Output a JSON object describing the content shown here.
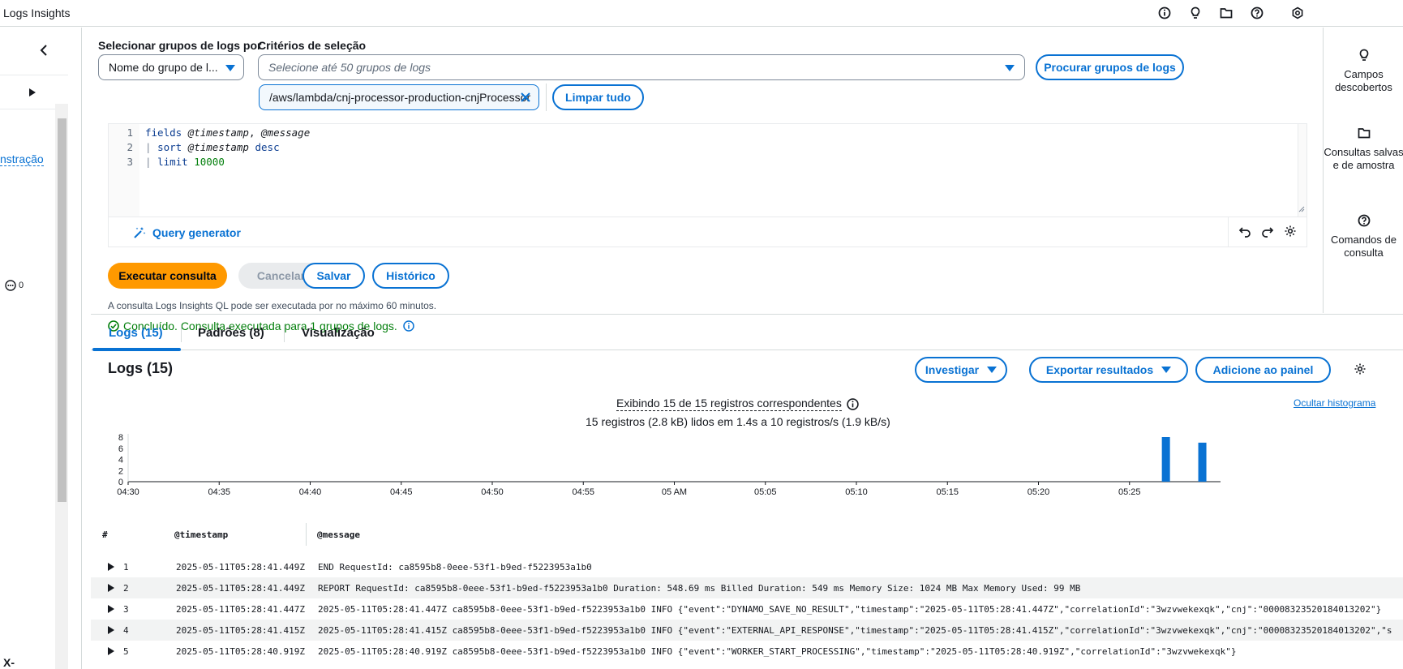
{
  "app": {
    "title": "Logs Insights"
  },
  "leftnav": {
    "link_text": "nstração",
    "count": "0",
    "bottom_text": "X-"
  },
  "query": {
    "select_groups_label": "Selecionar grupos de logs por",
    "select_groups_value": "Nome do grupo de l...",
    "criteria_label": "Critérios de seleção",
    "criteria_placeholder": "Selecione até 50 grupos de logs",
    "browse_button": "Procurar grupos de logs",
    "selected_token": "/aws/lambda/cnj-processor-production-cnjProcessor",
    "clear_all_button": "Limpar tudo",
    "editor_lines": [
      {
        "n": "1",
        "parts": [
          [
            "kw",
            "fields"
          ],
          [
            "",
            "",
            " "
          ],
          [
            "at",
            "@timestamp"
          ],
          [
            "",
            ", "
          ],
          [
            "at",
            "@message"
          ]
        ]
      },
      {
        "n": "2",
        "parts": [
          [
            "pipe",
            "| "
          ],
          [
            "kw",
            "sort"
          ],
          [
            "",
            " "
          ],
          [
            "at",
            "@timestamp"
          ],
          [
            "",
            " "
          ],
          [
            "kw",
            "desc"
          ]
        ]
      },
      {
        "n": "3",
        "parts": [
          [
            "pipe",
            "| "
          ],
          [
            "kw",
            "limit"
          ],
          [
            "",
            " "
          ],
          [
            "num",
            "10000"
          ]
        ]
      }
    ],
    "query_generator": "Query generator",
    "run_button": "Executar consulta",
    "cancel_button": "Cancelar",
    "save_button": "Salvar",
    "history_button": "Histórico",
    "hint": "A consulta Logs Insights QL pode ser executada por no máximo 60 minutos.",
    "status": "Concluído. Consulta executada para 1 grupos de logs."
  },
  "rightpanel": {
    "items": [
      {
        "label": "Campos descobertos",
        "icon": "lightbulb-icon"
      },
      {
        "label": "Consultas salvas e de amostra",
        "icon": "folder-icon"
      },
      {
        "label": "Comandos de consulta",
        "icon": "help-icon"
      }
    ]
  },
  "tabs": [
    {
      "label": "Logs (15)",
      "active": true
    },
    {
      "label": "Padrões (8)",
      "active": false
    },
    {
      "label": "Visualização",
      "active": false
    }
  ],
  "logs": {
    "title": "Logs (15)",
    "investigate_button": "Investigar",
    "export_button": "Exportar resultados",
    "add_dashboard_button": "Adicione ao painel",
    "hist_info1": "Exibindo 15 de 15 registros correspondentes",
    "hist_info2": "15 registros (2.8 kB) lidos em 1.4s a 10 registros/s (1.9 kB/s)",
    "hide_histogram": "Ocultar histograma",
    "columns": [
      "#",
      "@timestamp",
      "@message"
    ],
    "rows": [
      {
        "n": "1",
        "ts": "2025-05-11T05:28:41.449Z",
        "msg": "END RequestId: ca8595b8-0eee-53f1-b9ed-f5223953a1b0"
      },
      {
        "n": "2",
        "ts": "2025-05-11T05:28:41.449Z",
        "msg": "REPORT RequestId: ca8595b8-0eee-53f1-b9ed-f5223953a1b0 Duration: 548.69 ms Billed Duration: 549 ms Memory Size: 1024 MB Max Memory Used: 99 MB"
      },
      {
        "n": "3",
        "ts": "2025-05-11T05:28:41.447Z",
        "msg": "2025-05-11T05:28:41.447Z ca8595b8-0eee-53f1-b9ed-f5223953a1b0 INFO {\"event\":\"DYNAMO_SAVE_NO_RESULT\",\"timestamp\":\"2025-05-11T05:28:41.447Z\",\"correlationId\":\"3wzvwekexqk\",\"cnj\":\"00008323520184013202\"}"
      },
      {
        "n": "4",
        "ts": "2025-05-11T05:28:41.415Z",
        "msg": "2025-05-11T05:28:41.415Z ca8595b8-0eee-53f1-b9ed-f5223953a1b0 INFO {\"event\":\"EXTERNAL_API_RESPONSE\",\"timestamp\":\"2025-05-11T05:28:41.415Z\",\"correlationId\":\"3wzvwekexqk\",\"cnj\":\"00008323520184013202\",\"s"
      },
      {
        "n": "5",
        "ts": "2025-05-11T05:28:40.919Z",
        "msg": "2025-05-11T05:28:40.919Z ca8595b8-0eee-53f1-b9ed-f5223953a1b0 INFO {\"event\":\"WORKER_START_PROCESSING\",\"timestamp\":\"2025-05-11T05:28:40.919Z\",\"correlationId\":\"3wzvwekexqk\"}"
      }
    ]
  },
  "chart_data": {
    "type": "bar",
    "x_ticks": [
      "04:30",
      "04:35",
      "04:40",
      "04:45",
      "04:50",
      "04:55",
      "05 AM",
      "05:05",
      "05:10",
      "05:15",
      "05:20",
      "05:25"
    ],
    "y_ticks": [
      "0",
      "2",
      "4",
      "6",
      "8"
    ],
    "ylim": [
      0,
      8
    ],
    "x_range": [
      "04:30",
      "05:30"
    ],
    "bar_color": "#0972d3",
    "bars": [
      {
        "x": "05:27",
        "value": 8
      },
      {
        "x": "05:29",
        "value": 7
      }
    ]
  }
}
